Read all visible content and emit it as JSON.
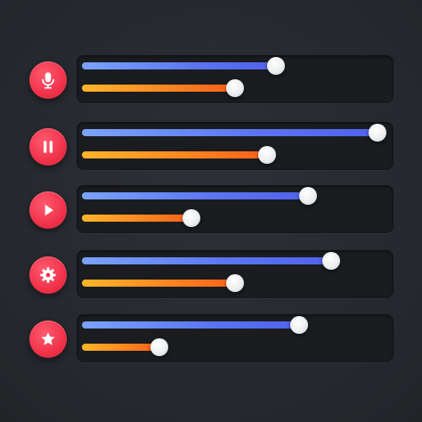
{
  "colors": {
    "background": "#26292e",
    "panel": "#1a1c20",
    "icon_button": "#f0324a",
    "slider_a": "#5b74f2",
    "slider_b": "#ff7a1e",
    "knob": "#eceef0"
  },
  "rows": [
    {
      "icon": "microphone-icon",
      "slider_a": 0.65,
      "slider_b": 0.51
    },
    {
      "icon": "pause-icon",
      "slider_a": 1.0,
      "slider_b": 0.62
    },
    {
      "icon": "play-icon",
      "slider_a": 0.76,
      "slider_b": 0.36
    },
    {
      "icon": "gear-icon",
      "slider_a": 0.84,
      "slider_b": 0.51
    },
    {
      "icon": "star-icon",
      "slider_a": 0.73,
      "slider_b": 0.25
    }
  ]
}
